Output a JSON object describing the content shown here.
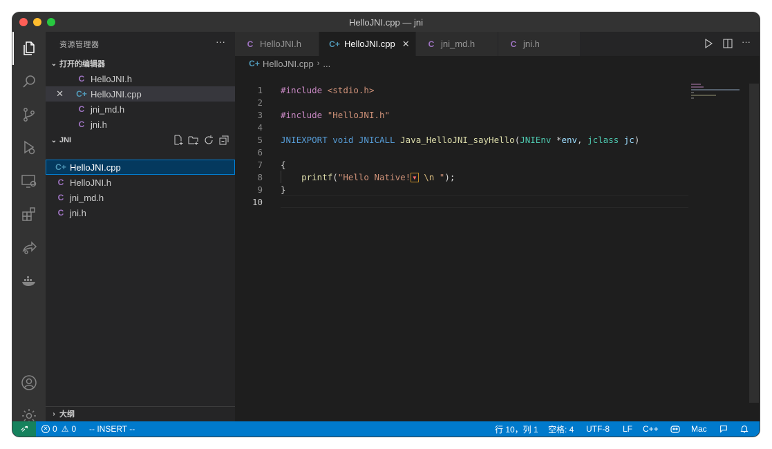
{
  "window": {
    "title": "HelloJNI.cpp — jni"
  },
  "colors": {
    "status_bar": "#007acc",
    "remote": "#16825d",
    "c_icon": "#a074c4",
    "cpp_icon": "#519aba"
  },
  "activity": {
    "icons": [
      "explorer-icon",
      "search-icon",
      "source-control-icon",
      "run-debug-icon",
      "remote-explorer-icon",
      "extensions-icon",
      "live-share-icon",
      "docker-icon",
      "account-icon",
      "settings-gear-icon"
    ]
  },
  "sidebar": {
    "title": "资源管理器",
    "more": "···",
    "open_editors": {
      "header": "打开的编辑器",
      "items": [
        {
          "icon": "C",
          "label": "HelloJNI.h"
        },
        {
          "icon": "C+",
          "label": "HelloJNI.cpp",
          "close": "✕"
        },
        {
          "icon": "C",
          "label": "jni_md.h"
        },
        {
          "icon": "C",
          "label": "jni.h"
        }
      ]
    },
    "folder": {
      "header": "JNI",
      "items": [
        {
          "icon": "C+",
          "label": "HelloJNI.cpp"
        },
        {
          "icon": "C",
          "label": "HelloJNI.h"
        },
        {
          "icon": "C",
          "label": "jni_md.h"
        },
        {
          "icon": "C",
          "label": "jni.h"
        }
      ]
    },
    "outline": {
      "header": "大纲"
    }
  },
  "tabs": [
    {
      "icon": "C",
      "label": "HelloJNI.h"
    },
    {
      "icon": "C+",
      "label": "HelloJNI.cpp",
      "close": "✕"
    },
    {
      "icon": "C",
      "label": "jni_md.h"
    },
    {
      "icon": "C",
      "label": "jni.h"
    }
  ],
  "breadcrumb": {
    "icon": "C+",
    "file": "HelloJNI.cpp",
    "sep": "›",
    "rest": "..."
  },
  "editor": {
    "line_numbers": [
      "1",
      "2",
      "3",
      "4",
      "5",
      "6",
      "7",
      "8",
      "9",
      "10"
    ],
    "current_line": "10"
  },
  "status": {
    "errors": "0",
    "warnings": "0",
    "mode": "-- INSERT --",
    "position": "行 10，列 1",
    "spaces": "空格: 4",
    "encoding": "UTF-8",
    "eol": "LF",
    "language": "C++",
    "platform": "Mac"
  }
}
